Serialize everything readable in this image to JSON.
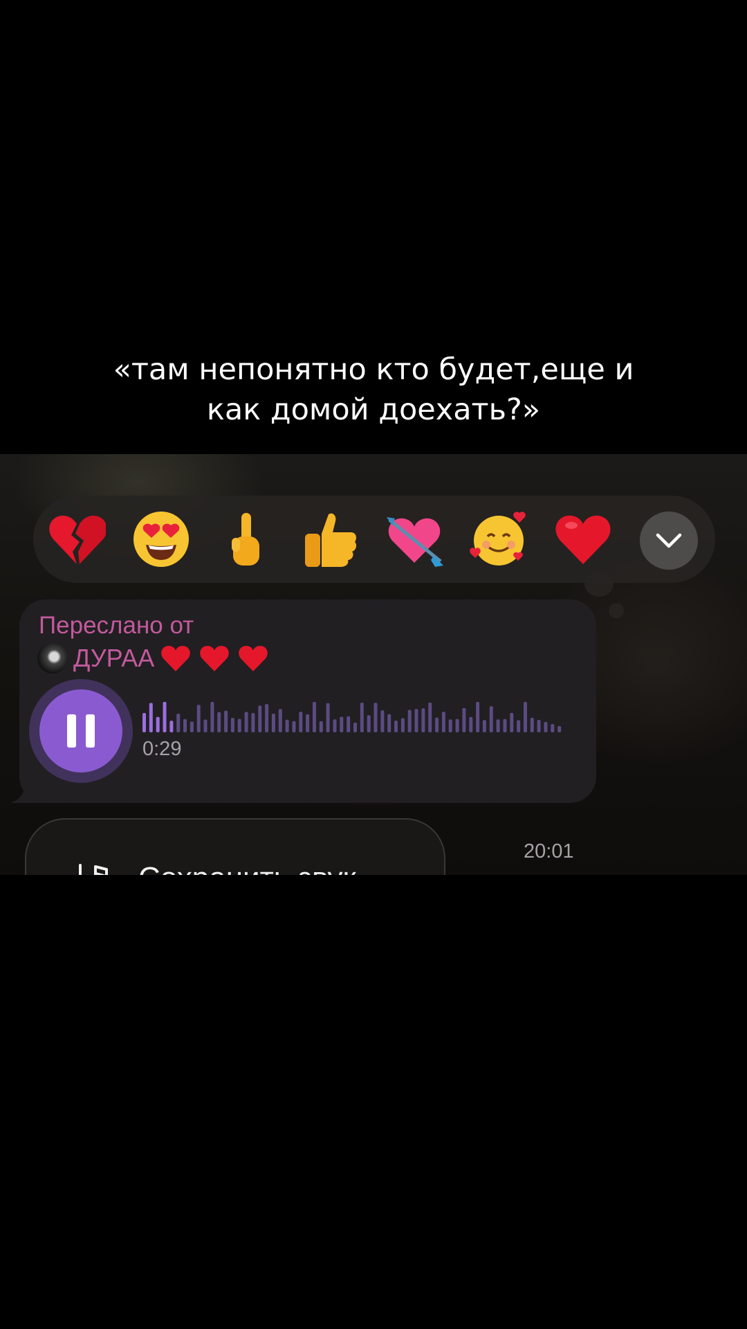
{
  "caption": {
    "line1": "«там непонятно кто будет,еще и",
    "line2": "как домой доехать?»"
  },
  "reactions": [
    {
      "icon": "broken-heart"
    },
    {
      "icon": "heart-eyes-face"
    },
    {
      "icon": "middle-finger"
    },
    {
      "icon": "thumbs-up"
    },
    {
      "icon": "heart-with-arrow"
    },
    {
      "icon": "smiling-face-with-hearts"
    },
    {
      "icon": "red-heart"
    }
  ],
  "message": {
    "forwarded_label": "Переслано от",
    "forwarded_from": "ДУРАА",
    "forwarded_from_hearts": [
      "❤️",
      "❤️",
      "❤️"
    ],
    "duration": "0:29",
    "sent_time": "20:01",
    "playback_state": "playing",
    "played_fraction": 0.07
  },
  "save_sound": {
    "label": "Сохранить звук",
    "icon": "music-note-download-icon"
  },
  "colors": {
    "accent_purple": "#8a5bd0",
    "forward_pink": "#c35a9c",
    "bubble_bg": "#211f22",
    "reactions_bg": "#262422"
  }
}
